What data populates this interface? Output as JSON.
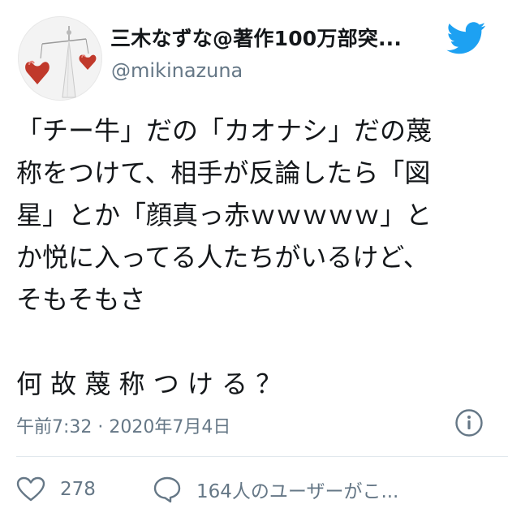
{
  "tweet": {
    "user": {
      "display_name": "三木なずな@著作100万部突...",
      "handle": "@mikinazuna",
      "avatar_icon": "heart-ornament-avatar"
    },
    "logo_icon": "twitter-bird-icon",
    "text": "「チー牛」だの「カオナシ」だの蔑\n称をつけて、相手が反論したら「図\n星」とか「顔真っ赤ｗｗｗｗｗ」と\nか悦に入ってる人たちがいるけど、\nそもそもさ\n\n何 故 蔑 称 つ け る ？",
    "timestamp": "午前7:32 · 2020年7月4日",
    "likes": "278",
    "replies": "164人のユーザーがこ...",
    "colors": {
      "brand_blue": "#1da1f2",
      "secondary_text": "#657786",
      "primary_text": "#14171a",
      "heart_red": "#c0392b"
    }
  }
}
